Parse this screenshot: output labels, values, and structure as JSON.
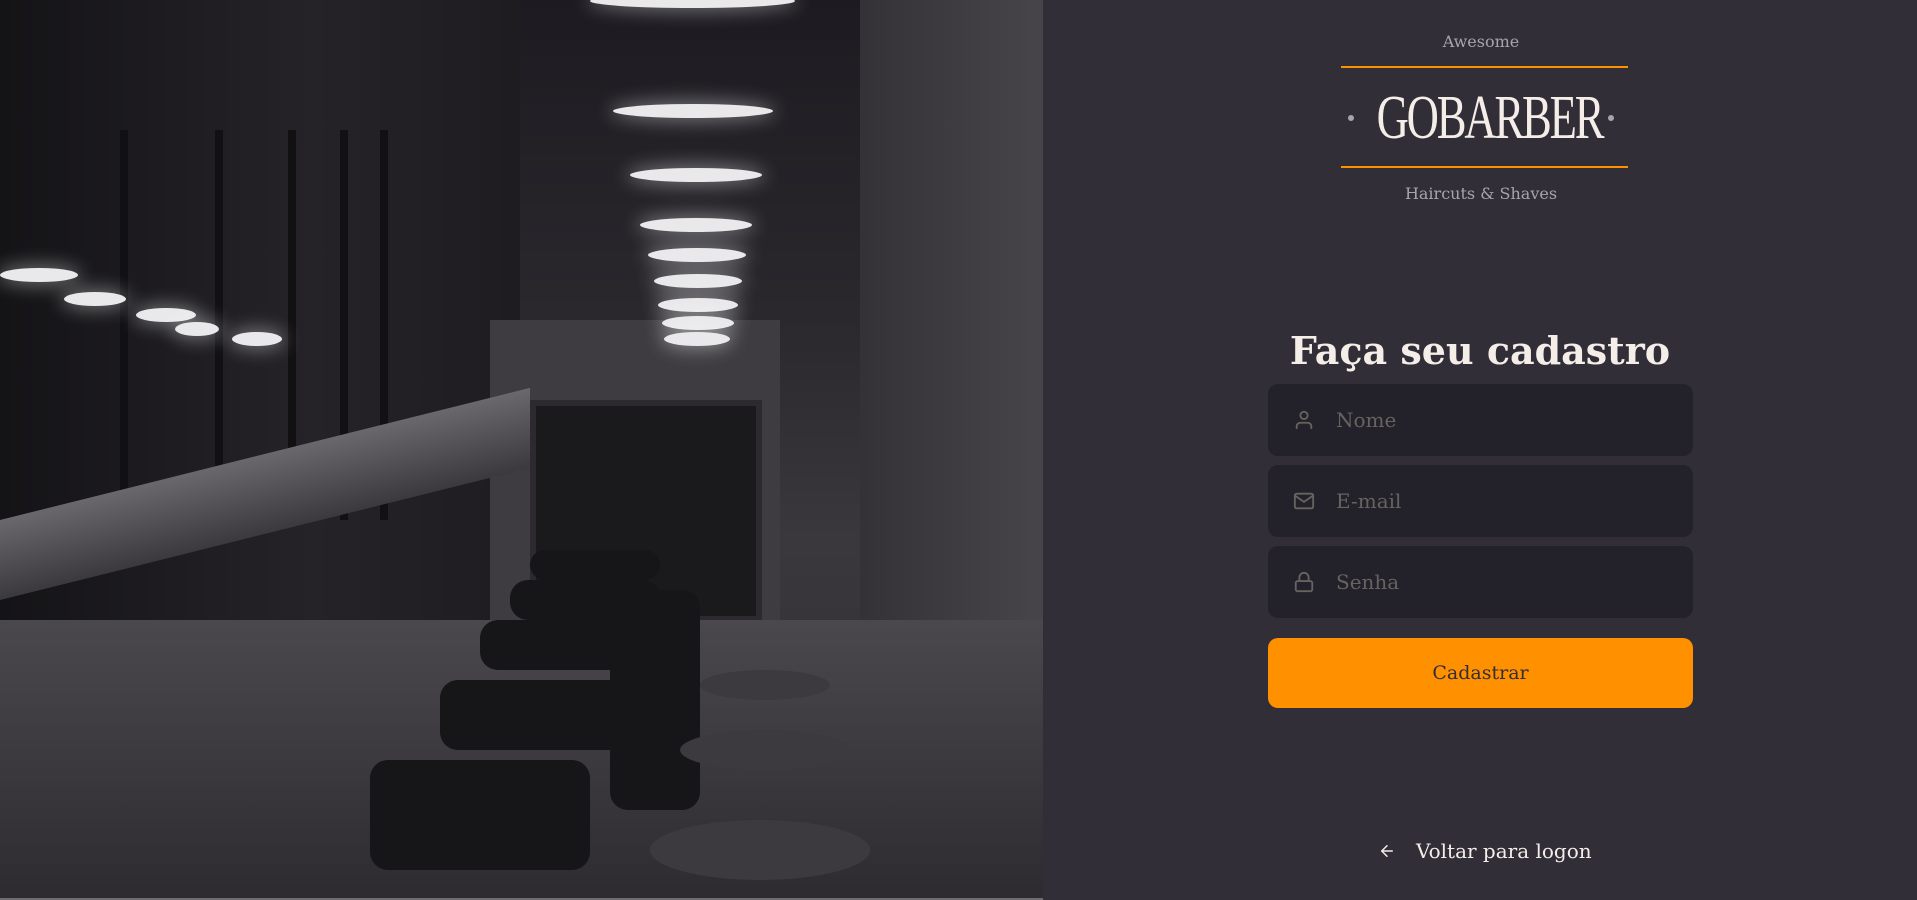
{
  "logo": {
    "tagline_top": "Awesome",
    "brand": "GOBARBER",
    "tagline_bottom": "Haircuts & Shaves",
    "accent_color": "#ff9000"
  },
  "form": {
    "title": "Faça seu cadastro",
    "fields": [
      {
        "name": "name",
        "icon": "user-icon",
        "placeholder": "Nome",
        "value": ""
      },
      {
        "name": "email",
        "icon": "mail-icon",
        "placeholder": "E-mail",
        "value": ""
      },
      {
        "name": "password",
        "icon": "lock-icon",
        "placeholder": "Senha",
        "value": ""
      }
    ],
    "submit_label": "Cadastrar"
  },
  "footer": {
    "back_icon": "arrow-left-icon",
    "back_label": "Voltar para logon"
  },
  "colors": {
    "background": "#312e38",
    "input_background": "#232129",
    "primary": "#ff9000",
    "text": "#f4ede8",
    "placeholder": "#666360"
  }
}
